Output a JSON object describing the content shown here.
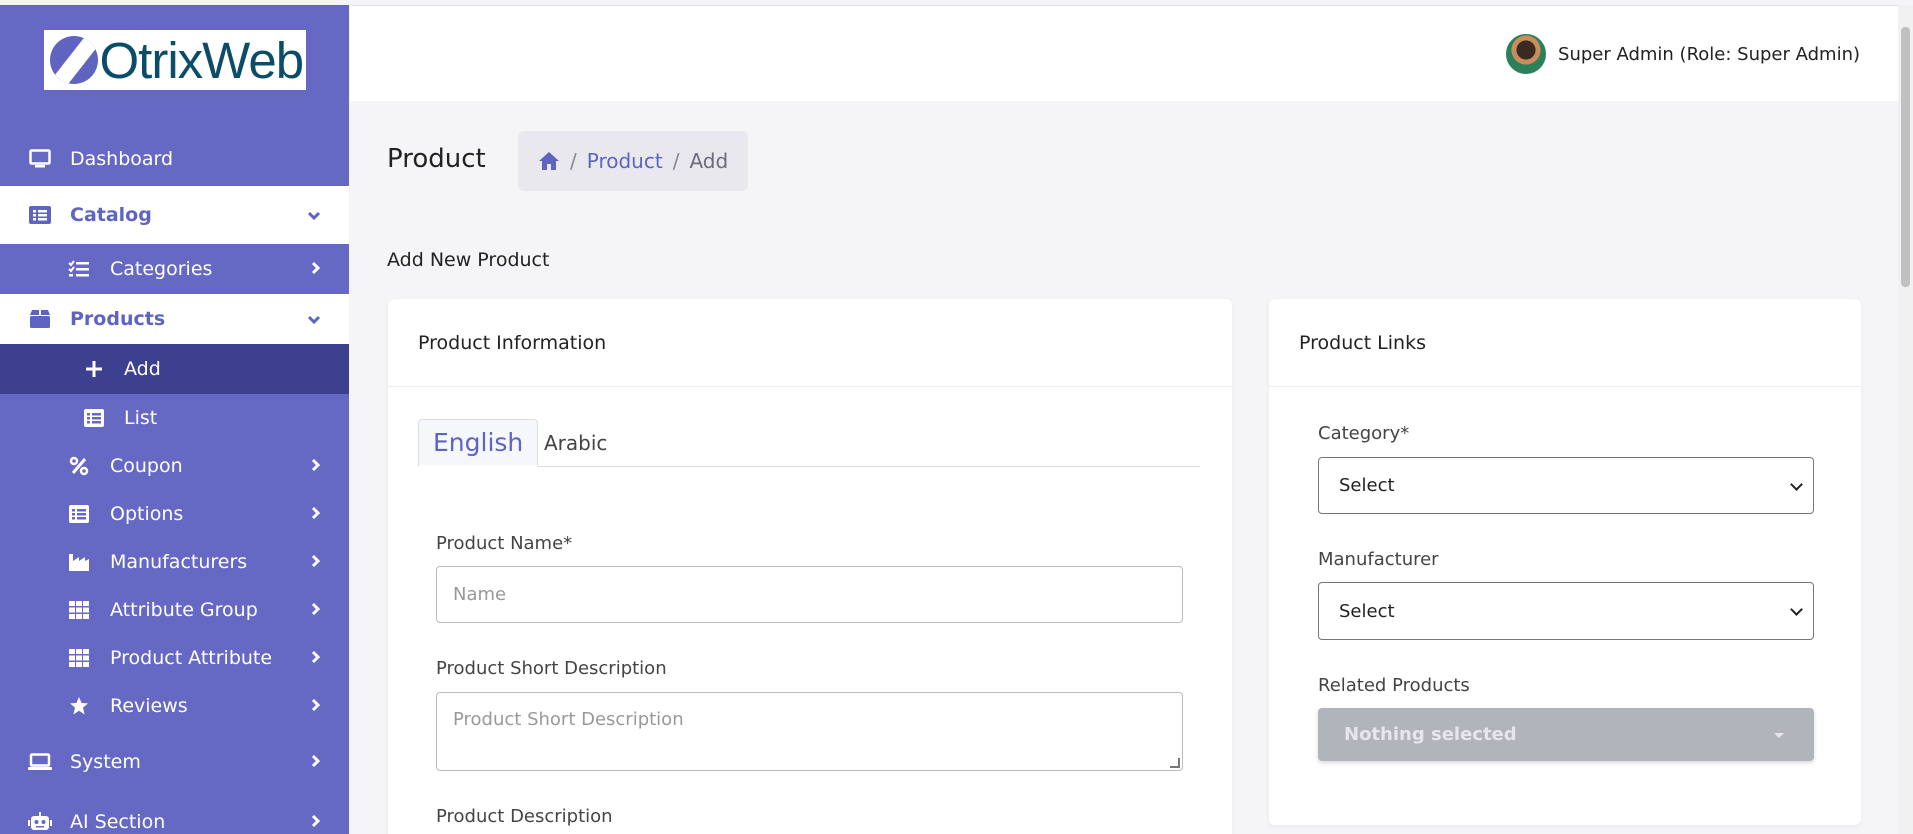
{
  "brand": {
    "logo_text": "OtrixWeb"
  },
  "sidebar": {
    "items": [
      {
        "label": "Dashboard",
        "icon": "monitor-icon"
      },
      {
        "label": "Catalog",
        "icon": "list-alt-icon"
      },
      {
        "label": "Categories",
        "icon": "tasks-icon"
      },
      {
        "label": "Products",
        "icon": "box-icon"
      },
      {
        "label": "Add",
        "icon": "plus-icon"
      },
      {
        "label": "List",
        "icon": "list-icon"
      },
      {
        "label": "Coupon",
        "icon": "percent-icon"
      },
      {
        "label": "Options",
        "icon": "list-alt-icon"
      },
      {
        "label": "Manufacturers",
        "icon": "industry-icon"
      },
      {
        "label": "Attribute Group",
        "icon": "grid-icon"
      },
      {
        "label": "Product Attribute",
        "icon": "grid-icon"
      },
      {
        "label": "Reviews",
        "icon": "star-icon"
      },
      {
        "label": "System",
        "icon": "laptop-icon"
      },
      {
        "label": "AI Section",
        "icon": "robot-icon"
      }
    ]
  },
  "header": {
    "user": "Super Admin (Role: Super Admin)"
  },
  "page": {
    "title": "Product",
    "breadcrumb": {
      "product": "Product",
      "current": "Add",
      "sep": "/"
    },
    "section_title": "Add New Product"
  },
  "product_info": {
    "title": "Product Information",
    "tabs": [
      "English",
      "Arabic"
    ],
    "name_label": "Product Name*",
    "name_placeholder": "Name",
    "short_desc_label": "Product Short Description",
    "short_desc_placeholder": "Product Short Description",
    "desc_label": "Product Description"
  },
  "product_links": {
    "title": "Product Links",
    "category_label": "Category*",
    "category_value": "Select",
    "manufacturer_label": "Manufacturer",
    "manufacturer_value": "Select",
    "related_label": "Related Products",
    "related_value": "Nothing selected"
  },
  "colors": {
    "sidebar": "#6569c3",
    "accent": "#5f64c1",
    "active": "#3d3f8f"
  }
}
